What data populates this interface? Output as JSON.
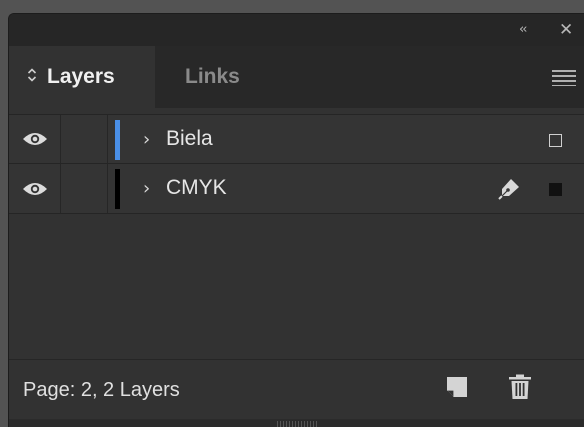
{
  "panel": {
    "collapse_glyph": "‹‹",
    "close_glyph": "✕"
  },
  "tabs": [
    {
      "label": "Layers",
      "active": true,
      "icon": "sort-updown-icon"
    },
    {
      "label": "Links",
      "active": false
    }
  ],
  "menu_icon": "hamburger-menu-icon",
  "layers": [
    {
      "name": "Biela",
      "color": "#4a8fe6",
      "visible": true,
      "selection": "empty",
      "target_icon": ""
    },
    {
      "name": "CMYK",
      "color": "#000000",
      "visible": true,
      "selection": "filled",
      "target_icon": "pen-nib-icon"
    }
  ],
  "footer": {
    "status": "Page: 2, 2 Layers",
    "icons": [
      "new-layer-icon",
      "trash-icon"
    ]
  }
}
